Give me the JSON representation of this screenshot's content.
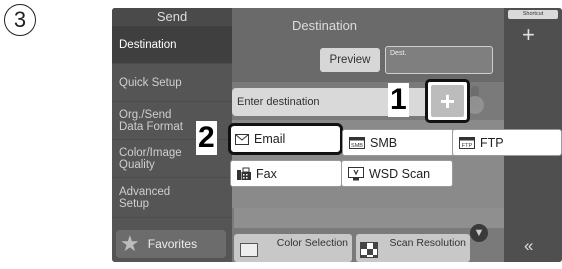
{
  "step_number": "3",
  "callouts": {
    "one": "1",
    "two": "2"
  },
  "sidebar": {
    "header": "Send",
    "items": [
      {
        "label": "Destination"
      },
      {
        "label": "Quick Setup"
      },
      {
        "line1": "Org./Send",
        "line2": "Data Format"
      },
      {
        "line1": "Color/Image",
        "line2": "Quality"
      },
      {
        "line1": "Advanced",
        "line2": "Setup"
      }
    ],
    "favorites": "Favorites"
  },
  "main": {
    "title": "Destination",
    "preview": "Preview",
    "dest_box": "Dest.",
    "enter_destination": "Enter destination",
    "color_selection": "Color Selection",
    "scan_resolution": "Scan Resolution"
  },
  "right": {
    "shortcut": "Shortcut",
    "plus": "+",
    "back": "«"
  },
  "add_button": {
    "symbol": "+"
  },
  "menu": {
    "email": "Email",
    "smb": "SMB",
    "ftp": "FTP",
    "fax": "Fax",
    "wsd": "WSD Scan",
    "smb_icon_text": "SMB",
    "ftp_icon_text": "FTP"
  }
}
